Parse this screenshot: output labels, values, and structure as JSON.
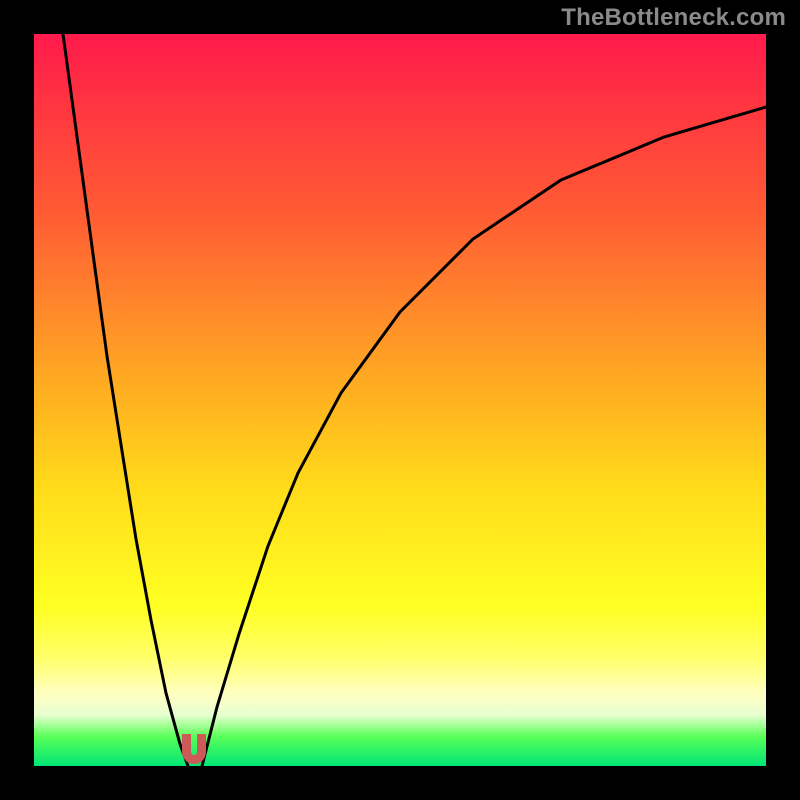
{
  "watermark": "TheBottleneck.com",
  "chart_data": {
    "type": "line",
    "title": "",
    "xlabel": "",
    "ylabel": "",
    "xlim": [
      0,
      100
    ],
    "ylim": [
      0,
      100
    ],
    "legend": false,
    "grid": false,
    "background": "red-yellow-green vertical gradient",
    "series": [
      {
        "name": "left-branch",
        "x": [
          4,
          6,
          8,
          10,
          12,
          14,
          16,
          18,
          20,
          21
        ],
        "y": [
          100,
          85,
          70,
          56,
          43,
          31,
          20,
          10,
          3,
          0
        ]
      },
      {
        "name": "right-branch",
        "x": [
          23,
          25,
          28,
          32,
          36,
          42,
          50,
          60,
          72,
          86,
          100
        ],
        "y": [
          0,
          8,
          18,
          30,
          40,
          51,
          62,
          72,
          80,
          86,
          90
        ]
      }
    ],
    "annotations": [
      {
        "name": "minimum-marker",
        "x": 22,
        "y": 2,
        "color": "#cc5a58"
      }
    ]
  }
}
